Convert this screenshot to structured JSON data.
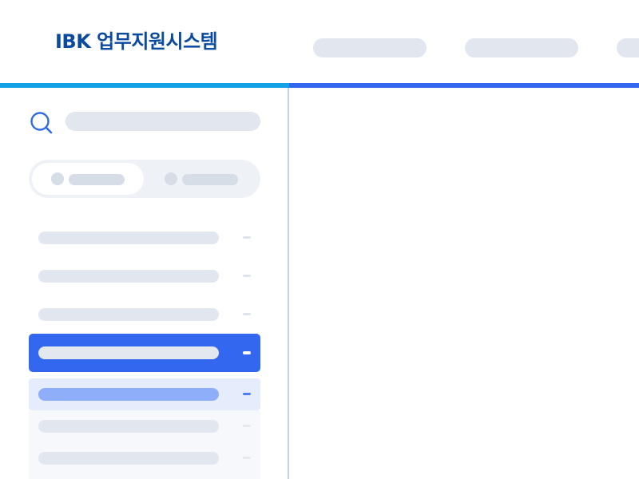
{
  "header": {
    "logo_text": "IBK 업무지원시스템",
    "nav_items": [
      "",
      "",
      ""
    ]
  },
  "sidebar": {
    "search": {
      "placeholder": "",
      "icon": "search-icon"
    },
    "toggle": {
      "options": [
        "",
        ""
      ],
      "selected_index": 0
    },
    "menu": {
      "items": [
        {
          "label": "",
          "state": "default"
        },
        {
          "label": "",
          "state": "default"
        },
        {
          "label": "",
          "state": "default"
        },
        {
          "label": "",
          "state": "selected"
        },
        {
          "label": "",
          "state": "hover"
        },
        {
          "label": "",
          "state": "sub"
        },
        {
          "label": "",
          "state": "sub"
        }
      ]
    }
  },
  "colors": {
    "brand": "#0b4aa1",
    "accent": "#3367f0",
    "accent_left": "#12a2e5",
    "placeholder": "#e2e7ef",
    "hover_bg": "#e5edfd",
    "hover_label": "#8eaef9",
    "divider": "#c6d0dc"
  }
}
